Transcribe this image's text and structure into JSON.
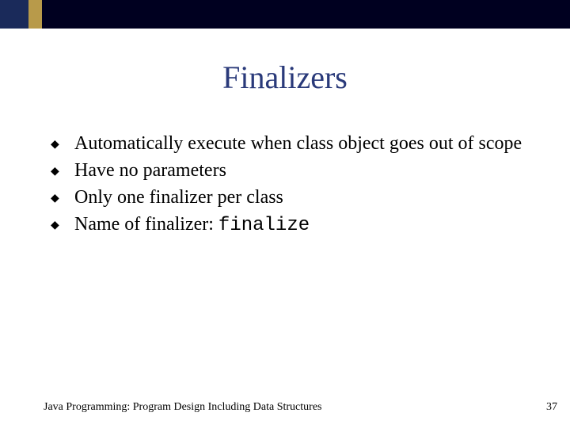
{
  "title": "Finalizers",
  "bullets": [
    {
      "text": "Automatically execute when class object goes out of scope"
    },
    {
      "text": "Have no parameters"
    },
    {
      "text": "Only one finalizer per class"
    },
    {
      "prefix": "Name of finalizer: ",
      "code": "finalize"
    }
  ],
  "footer": {
    "left": "Java Programming: Program Design Including Data Structures",
    "right": "37"
  }
}
